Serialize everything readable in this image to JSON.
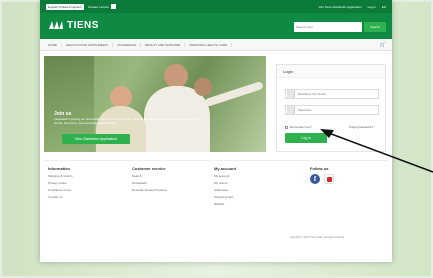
{
  "topbar": {
    "language": "English (United Kingdom)",
    "currency": "Greater London",
    "links": [
      "Join Tiens Distributor Application",
      "Log in",
      "EN"
    ]
  },
  "header": {
    "brand": "TIENS",
    "search_placeholder": "Search store",
    "search_button": "Search"
  },
  "nav": {
    "items": [
      "HOME",
      "HEALTH FOOD SUPPLEMENT",
      "HOUSEHOLD",
      "BEAUTY AND SKINCARE",
      "PERSONAL HEALTH CARE"
    ]
  },
  "hero": {
    "title": "Join us",
    "text": "Interested in joining our successful team? Visit our website, you will be able to shop, and join us for business, bonus, and many more amazing opportunities.",
    "button": "New Distributor Application"
  },
  "login": {
    "title": "Login",
    "id_placeholder": "Distributor ID / Email",
    "password_placeholder": "Password",
    "remember": "Remember me?",
    "forgot": "Forgot password?",
    "button": "Log in"
  },
  "footer": {
    "information": {
      "title": "Information",
      "links": [
        "Shipping & returns",
        "Privacy notice",
        "Conditions of use",
        "Contact us"
      ]
    },
    "customer_service": {
      "title": "Customer service",
      "links": [
        "Search",
        "Downloads",
        "Recently Viewed Products"
      ]
    },
    "my_account": {
      "title": "My account",
      "links": [
        "My account",
        "My orders",
        "Addresses",
        "Shopping Cart",
        "Wishlist"
      ]
    },
    "follow_us": {
      "title": "Follow us"
    },
    "copyright": "Copyright © 2017 Tiens Store. All rights reserved."
  },
  "colors": {
    "brand_green": "#0f8a43",
    "button_green": "#2fb24e",
    "facebook": "#3b5998"
  }
}
